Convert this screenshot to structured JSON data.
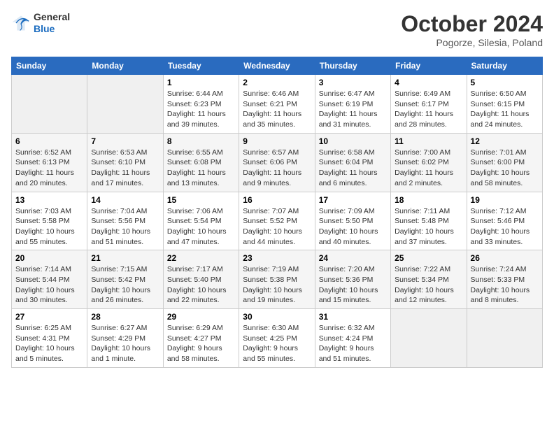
{
  "header": {
    "logo_general": "General",
    "logo_blue": "Blue",
    "month_title": "October 2024",
    "location": "Pogorze, Silesia, Poland"
  },
  "calendar": {
    "days_of_week": [
      "Sunday",
      "Monday",
      "Tuesday",
      "Wednesday",
      "Thursday",
      "Friday",
      "Saturday"
    ],
    "weeks": [
      [
        {
          "day": "",
          "content": ""
        },
        {
          "day": "",
          "content": ""
        },
        {
          "day": "1",
          "content": "Sunrise: 6:44 AM\nSunset: 6:23 PM\nDaylight: 11 hours and 39 minutes."
        },
        {
          "day": "2",
          "content": "Sunrise: 6:46 AM\nSunset: 6:21 PM\nDaylight: 11 hours and 35 minutes."
        },
        {
          "day": "3",
          "content": "Sunrise: 6:47 AM\nSunset: 6:19 PM\nDaylight: 11 hours and 31 minutes."
        },
        {
          "day": "4",
          "content": "Sunrise: 6:49 AM\nSunset: 6:17 PM\nDaylight: 11 hours and 28 minutes."
        },
        {
          "day": "5",
          "content": "Sunrise: 6:50 AM\nSunset: 6:15 PM\nDaylight: 11 hours and 24 minutes."
        }
      ],
      [
        {
          "day": "6",
          "content": "Sunrise: 6:52 AM\nSunset: 6:13 PM\nDaylight: 11 hours and 20 minutes."
        },
        {
          "day": "7",
          "content": "Sunrise: 6:53 AM\nSunset: 6:10 PM\nDaylight: 11 hours and 17 minutes."
        },
        {
          "day": "8",
          "content": "Sunrise: 6:55 AM\nSunset: 6:08 PM\nDaylight: 11 hours and 13 minutes."
        },
        {
          "day": "9",
          "content": "Sunrise: 6:57 AM\nSunset: 6:06 PM\nDaylight: 11 hours and 9 minutes."
        },
        {
          "day": "10",
          "content": "Sunrise: 6:58 AM\nSunset: 6:04 PM\nDaylight: 11 hours and 6 minutes."
        },
        {
          "day": "11",
          "content": "Sunrise: 7:00 AM\nSunset: 6:02 PM\nDaylight: 11 hours and 2 minutes."
        },
        {
          "day": "12",
          "content": "Sunrise: 7:01 AM\nSunset: 6:00 PM\nDaylight: 10 hours and 58 minutes."
        }
      ],
      [
        {
          "day": "13",
          "content": "Sunrise: 7:03 AM\nSunset: 5:58 PM\nDaylight: 10 hours and 55 minutes."
        },
        {
          "day": "14",
          "content": "Sunrise: 7:04 AM\nSunset: 5:56 PM\nDaylight: 10 hours and 51 minutes."
        },
        {
          "day": "15",
          "content": "Sunrise: 7:06 AM\nSunset: 5:54 PM\nDaylight: 10 hours and 47 minutes."
        },
        {
          "day": "16",
          "content": "Sunrise: 7:07 AM\nSunset: 5:52 PM\nDaylight: 10 hours and 44 minutes."
        },
        {
          "day": "17",
          "content": "Sunrise: 7:09 AM\nSunset: 5:50 PM\nDaylight: 10 hours and 40 minutes."
        },
        {
          "day": "18",
          "content": "Sunrise: 7:11 AM\nSunset: 5:48 PM\nDaylight: 10 hours and 37 minutes."
        },
        {
          "day": "19",
          "content": "Sunrise: 7:12 AM\nSunset: 5:46 PM\nDaylight: 10 hours and 33 minutes."
        }
      ],
      [
        {
          "day": "20",
          "content": "Sunrise: 7:14 AM\nSunset: 5:44 PM\nDaylight: 10 hours and 30 minutes."
        },
        {
          "day": "21",
          "content": "Sunrise: 7:15 AM\nSunset: 5:42 PM\nDaylight: 10 hours and 26 minutes."
        },
        {
          "day": "22",
          "content": "Sunrise: 7:17 AM\nSunset: 5:40 PM\nDaylight: 10 hours and 22 minutes."
        },
        {
          "day": "23",
          "content": "Sunrise: 7:19 AM\nSunset: 5:38 PM\nDaylight: 10 hours and 19 minutes."
        },
        {
          "day": "24",
          "content": "Sunrise: 7:20 AM\nSunset: 5:36 PM\nDaylight: 10 hours and 15 minutes."
        },
        {
          "day": "25",
          "content": "Sunrise: 7:22 AM\nSunset: 5:34 PM\nDaylight: 10 hours and 12 minutes."
        },
        {
          "day": "26",
          "content": "Sunrise: 7:24 AM\nSunset: 5:33 PM\nDaylight: 10 hours and 8 minutes."
        }
      ],
      [
        {
          "day": "27",
          "content": "Sunrise: 6:25 AM\nSunset: 4:31 PM\nDaylight: 10 hours and 5 minutes."
        },
        {
          "day": "28",
          "content": "Sunrise: 6:27 AM\nSunset: 4:29 PM\nDaylight: 10 hours and 1 minute."
        },
        {
          "day": "29",
          "content": "Sunrise: 6:29 AM\nSunset: 4:27 PM\nDaylight: 9 hours and 58 minutes."
        },
        {
          "day": "30",
          "content": "Sunrise: 6:30 AM\nSunset: 4:25 PM\nDaylight: 9 hours and 55 minutes."
        },
        {
          "day": "31",
          "content": "Sunrise: 6:32 AM\nSunset: 4:24 PM\nDaylight: 9 hours and 51 minutes."
        },
        {
          "day": "",
          "content": ""
        },
        {
          "day": "",
          "content": ""
        }
      ]
    ]
  }
}
